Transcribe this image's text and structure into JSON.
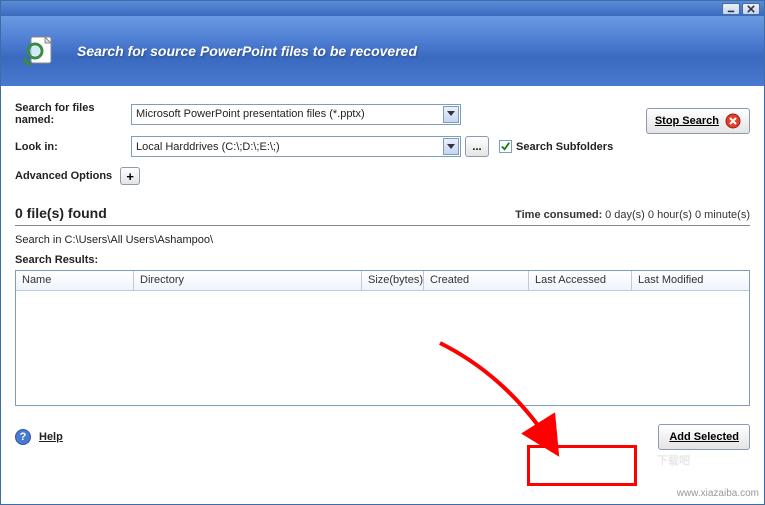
{
  "titlebar": {
    "minimize_icon": "minimize",
    "close_icon": "close"
  },
  "header": {
    "title": "Search for source PowerPoint files to be recovered"
  },
  "form": {
    "search_files_label": "Search for files named:",
    "file_type_value": "Microsoft PowerPoint presentation files (*.pptx)",
    "look_in_label": "Look in:",
    "look_in_value": "Local Harddrives (C:\\;D:\\;E:\\;)",
    "browse_label": "...",
    "subfolders_label": "Search Subfolders",
    "subfolders_checked": true,
    "advanced_label": "Advanced Options",
    "expand_label": "+",
    "stop_label": "Stop Search"
  },
  "status": {
    "files_found": "0 file(s) found",
    "time_label": "Time consumed:",
    "time_value": "0 day(s) 0 hour(s) 0 minute(s)",
    "search_path": "Search in C:\\Users\\All Users\\Ashampoo\\"
  },
  "results": {
    "label": "Search Results:",
    "columns": {
      "name": "Name",
      "directory": "Directory",
      "size": "Size(bytes)",
      "created": "Created",
      "last_accessed": "Last Accessed",
      "last_modified": "Last Modified"
    }
  },
  "footer": {
    "help_label": "Help",
    "add_selected_label": "Add Selected"
  },
  "watermark": {
    "text": "www.xiazaiba.com",
    "logo": "下载吧"
  }
}
